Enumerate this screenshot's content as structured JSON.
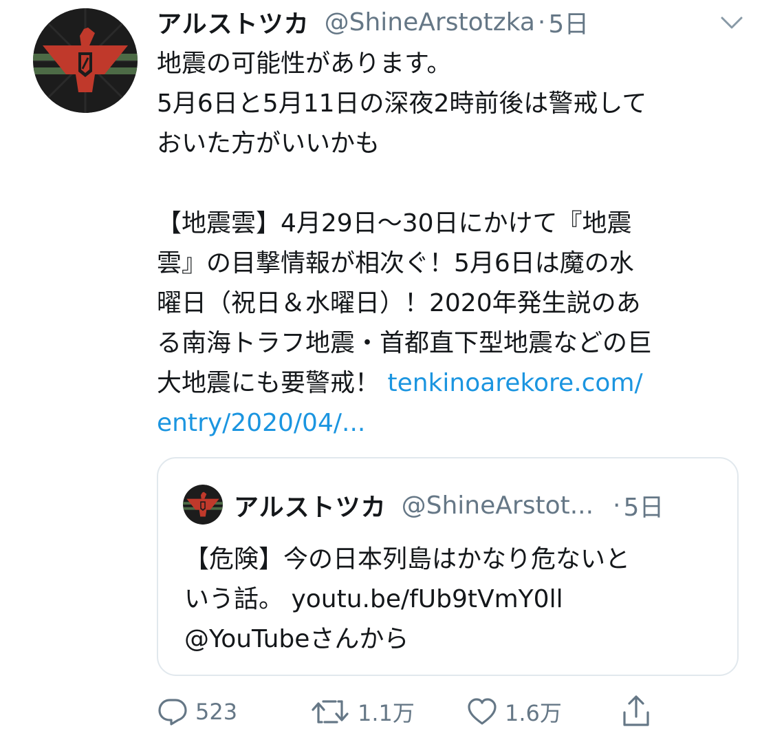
{
  "tweet": {
    "display_name": "アルストツカ",
    "handle": "@ShineArstotzka",
    "separator": "·",
    "time": "5日",
    "text_lines": [
      "地震の可能性があります。",
      "5月6日と5月11日の深夜2時前後は警戒して",
      "おいた方がいいかも"
    ],
    "article_lines": [
      "【地震雲】4月29日～30日にかけて『地震",
      "雲』の目撃情報が相次ぐ！5月6日は魔の水",
      "曜日（祝日＆水曜日）！2020年発生説のあ",
      "る南海トラフ地震・首都直下型地震などの巨"
    ],
    "last_line_text": "大地震にも要警戒！ ",
    "link_part1": "tenkinoarekore.com/",
    "link_part2": "entry/2020/04/..."
  },
  "quoted_tweet": {
    "display_name": "アルストツカ",
    "handle": "@ShineArstot...",
    "separator": "·",
    "time": "5日",
    "text_lines": [
      "【危険】今の日本列島はかなり危ないと",
      "いう話。 youtu.be/fUb9tVmY0ll",
      "@YouTubeさんから"
    ]
  },
  "actions": {
    "reply_count": "523",
    "retweet_count": "1.1万",
    "like_count": "1.6万"
  },
  "colors": {
    "link": "#1b95e0",
    "secondary_text": "#657786",
    "border": "#e1e8ed",
    "avatar_red": "#c0392b",
    "avatar_green": "#4d6b46"
  },
  "icons": {
    "avatar": "arstotzka-eagle-emblem",
    "more": "chevron-down-icon",
    "reply": "reply-icon",
    "retweet": "retweet-icon",
    "like": "heart-icon",
    "share": "share-icon"
  }
}
